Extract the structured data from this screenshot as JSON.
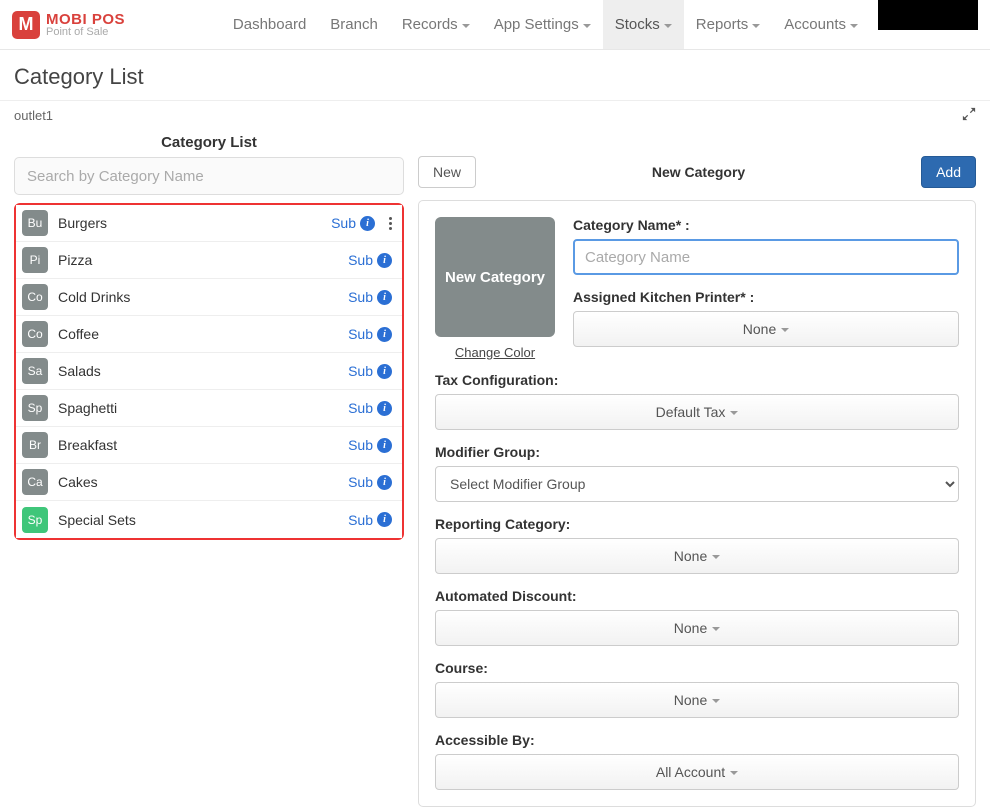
{
  "logo": {
    "title": "MOBI POS",
    "subtitle": "Point of Sale",
    "badge": "M"
  },
  "nav": {
    "dashboard": "Dashboard",
    "branch": "Branch",
    "records": "Records",
    "appsettings": "App Settings",
    "stocks": "Stocks",
    "reports": "Reports",
    "accounts": "Accounts"
  },
  "page_title": "Category List",
  "outlet": "outlet1",
  "left": {
    "header": "Category List",
    "search_placeholder": "Search by Category Name",
    "sub_label": "Sub"
  },
  "categories": [
    {
      "abbr": "Bu",
      "name": "Burgers",
      "color": "grey",
      "more": true
    },
    {
      "abbr": "Pi",
      "name": "Pizza",
      "color": "grey",
      "more": false
    },
    {
      "abbr": "Co",
      "name": "Cold Drinks",
      "color": "grey",
      "more": false
    },
    {
      "abbr": "Co",
      "name": "Coffee",
      "color": "grey",
      "more": false
    },
    {
      "abbr": "Sa",
      "name": "Salads",
      "color": "grey",
      "more": false
    },
    {
      "abbr": "Sp",
      "name": "Spaghetti",
      "color": "grey",
      "more": false
    },
    {
      "abbr": "Br",
      "name": "Breakfast",
      "color": "grey",
      "more": false
    },
    {
      "abbr": "Ca",
      "name": "Cakes",
      "color": "grey",
      "more": false
    },
    {
      "abbr": "Sp",
      "name": "Special Sets",
      "color": "green",
      "more": false
    }
  ],
  "right": {
    "new_btn": "New",
    "header": "New Category",
    "add_btn": "Add",
    "swatch_text": "New Category",
    "change_color": "Change Color",
    "labels": {
      "name": "Category Name* :",
      "name_placeholder": "Category Name",
      "printer": "Assigned Kitchen Printer* :",
      "printer_value": "None",
      "tax": "Tax Configuration:",
      "tax_value": "Default Tax",
      "modgroup": "Modifier Group:",
      "modgroup_value": "Select Modifier Group",
      "report": "Reporting Category:",
      "report_value": "None",
      "discount": "Automated Discount:",
      "discount_value": "None",
      "course": "Course:",
      "course_value": "None",
      "accessible": "Accessible By:",
      "accessible_value": "All Account"
    }
  }
}
